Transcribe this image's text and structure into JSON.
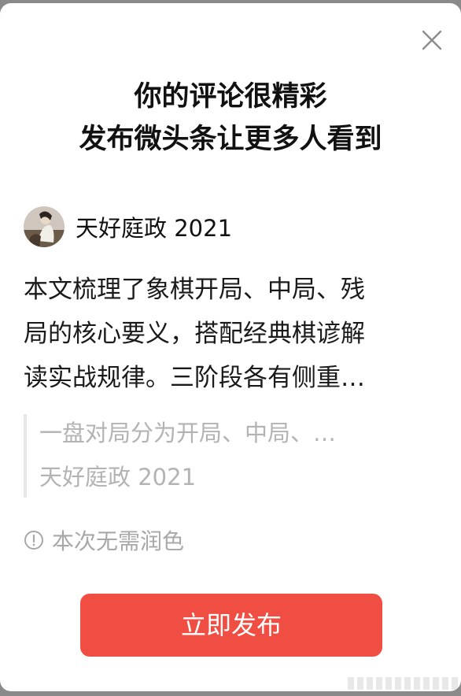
{
  "dialog": {
    "close_icon": "close-icon",
    "title_line1": "你的评论很精彩",
    "title_line2": "发布微头条让更多人看到"
  },
  "author": {
    "name": "天好庭政 2021",
    "avatar_icon": "avatar"
  },
  "comment": {
    "line1": "本文梳理了象棋开局、中局、残",
    "line2": "局的核心要义，搭配经典棋谚解",
    "line3": "读实战规律。三阶段各有侧重…"
  },
  "quote": {
    "text": "一盘对局分为开局、中局、…",
    "source": "天好庭政 2021"
  },
  "note": {
    "icon": "info-icon",
    "text": "本次无需润色"
  },
  "publish_button": {
    "label": "立即发布",
    "color": "#f04e43"
  }
}
